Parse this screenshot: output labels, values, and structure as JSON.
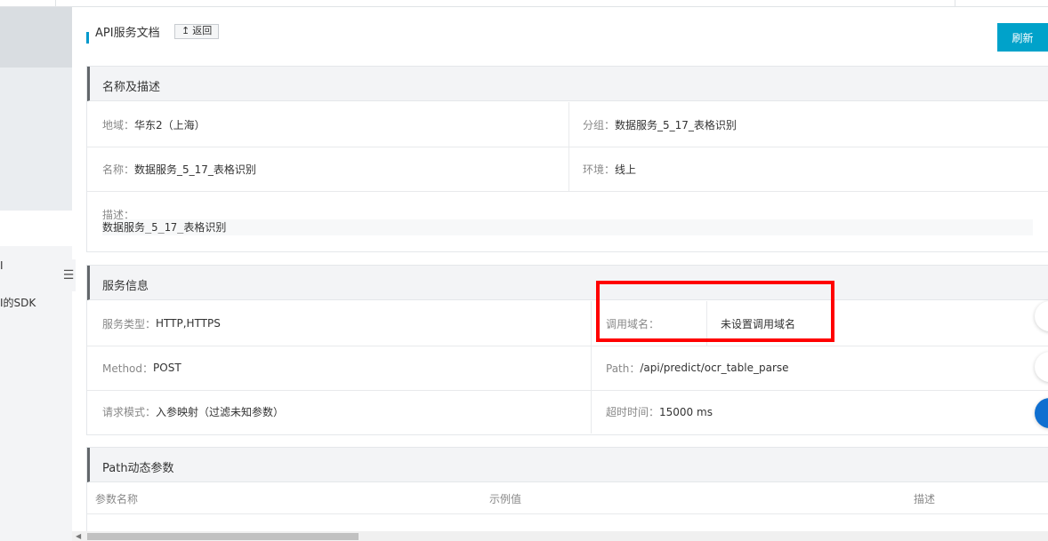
{
  "left_nav": {
    "item1": "I",
    "item2": "I的SDK"
  },
  "header": {
    "title": "API服务文档",
    "back_label": "返回",
    "refresh_label": "刷新"
  },
  "section1": {
    "title": "名称及描述",
    "region_label": "地域：",
    "region_value": "华东2（上海）",
    "group_label": "分组：",
    "group_value": "数据服务_5_17_表格识别",
    "name_label": "名称：",
    "name_value": "数据服务_5_17_表格识别",
    "env_label": "环境：",
    "env_value": "线上",
    "desc_label": "描述：",
    "desc_value": "数据服务_5_17_表格识别"
  },
  "section2": {
    "title": "服务信息",
    "service_type_label": "服务类型：",
    "service_type_value": "HTTP,HTTPS",
    "domain_label": "调用域名：",
    "domain_value": "未设置调用域名",
    "method_label": "Method：",
    "method_value": "POST",
    "path_label": "Path：",
    "path_value": "/api/predict/ocr_table_parse",
    "mode_label": "请求模式：",
    "mode_value": "入参映射（过滤未知参数）",
    "timeout_label": "超时时间：",
    "timeout_value": "15000 ms"
  },
  "section3": {
    "title": "Path动态参数",
    "columns": [
      "参数名称",
      "示例值",
      "描述"
    ]
  },
  "colors": {
    "accent": "#00a2ca",
    "highlight": "#ff0000"
  }
}
